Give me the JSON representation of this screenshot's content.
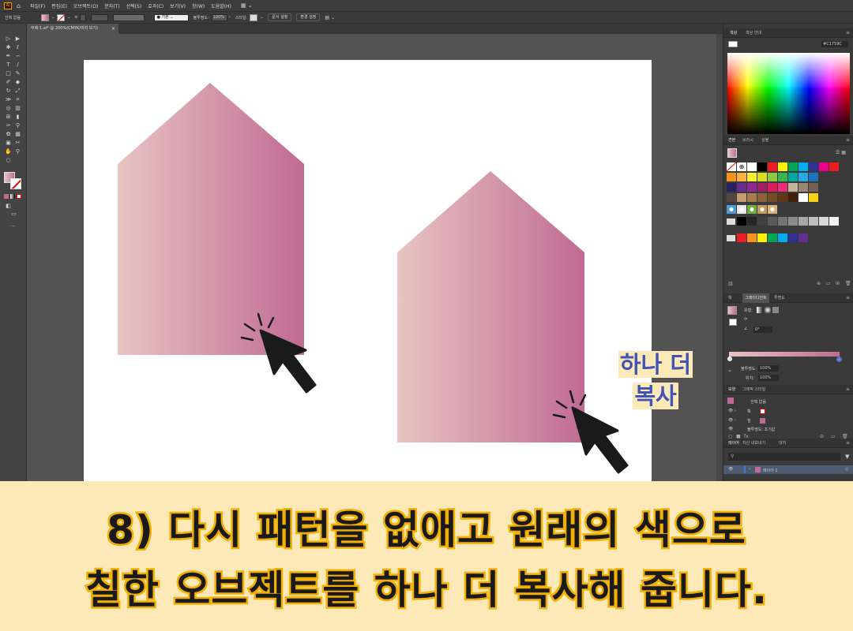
{
  "menubar": {
    "logo": "Ai",
    "items": [
      "파일(F)",
      "편집(E)",
      "오브젝트(O)",
      "문자(T)",
      "선택(S)",
      "효과(C)",
      "보기(V)",
      "창(W)",
      "도움말(H)"
    ]
  },
  "controlbar": {
    "selection_label": "선택 없음",
    "stroke_style": "기본",
    "opacity_label": "불투명도:",
    "opacity_value": "100%",
    "style_label": "스타일:",
    "doc_setup_button": "문서 설정",
    "preferences_button": "환경 설정"
  },
  "document_tab": {
    "title": "무제-1.ai* @ 200%(CMYK/미리 보기)",
    "close": "×"
  },
  "color_panel": {
    "tabs": [
      "색상",
      "색상 안내"
    ],
    "hex_value": "C1759C"
  },
  "swatches_panel": {
    "tabs": [
      "견본",
      "브러시",
      "심볼"
    ],
    "row1": [
      "#ffffff",
      "#000000",
      "#ed1c24",
      "#fff200",
      "#00a651",
      "#00aeef",
      "#2e3192",
      "#ec008c",
      "#ed1c24"
    ],
    "row2": [
      "#f7941d",
      "#fbb040",
      "#f9ed32",
      "#d7df23",
      "#8dc63f",
      "#39b54a",
      "#00a79d",
      "#27aae1",
      "#1c75bc"
    ],
    "row3": [
      "#262262",
      "#662d91",
      "#92278f",
      "#9e1f63",
      "#da1c5c",
      "#ee2a7b",
      "#c2b59b",
      "#998675",
      "#736357"
    ],
    "row4": [
      "#534741",
      "#c69c6d",
      "#a67c52",
      "#8c6239",
      "#754c24",
      "#603813",
      "#42210b",
      "#ffffff",
      "#f7d117"
    ],
    "grays": [
      "#000000",
      "#262626",
      "#404040",
      "#595959",
      "#737373",
      "#8c8c8c",
      "#a6a6a6",
      "#bfbfbf",
      "#d9d9d9",
      "#f2f2f2"
    ],
    "brights": [
      "#ed1c24",
      "#f7941d",
      "#fff200",
      "#00a651",
      "#00aeef",
      "#2e3192",
      "#662d91"
    ]
  },
  "gradient_panel": {
    "tabs": [
      "획",
      "그레이디언트",
      "투명도"
    ],
    "type_label": "유형:",
    "angle_value": "0°",
    "opacity_label": "불투명도:",
    "opacity_value": "100%",
    "location_label": "위치:",
    "location_value": "100%",
    "start_color": "#e8c4c2",
    "end_color": "#c06b93"
  },
  "appearance_panel": {
    "tabs": [
      "모양",
      "그래픽 스타일"
    ],
    "title_row": "선택 없음",
    "stroke_row": "획",
    "fill_row": "칠",
    "opacity_row": "불투명도: 초기값"
  },
  "layers_panel": {
    "tabs": [
      "레이어",
      "자산 내보내기",
      "대지"
    ],
    "layer_name": "레이어 1"
  },
  "canvas": {
    "shape_color_start": "#e8c4c2",
    "shape_color_end": "#c06b93"
  },
  "annotation": {
    "line1": "하나 더",
    "line2": "복사"
  },
  "caption": {
    "line1": "8) 다시 패턴을 없애고 원래의 색으로",
    "line2": "칠한 오브젝트를 하나 더 복사해 줍니다."
  }
}
